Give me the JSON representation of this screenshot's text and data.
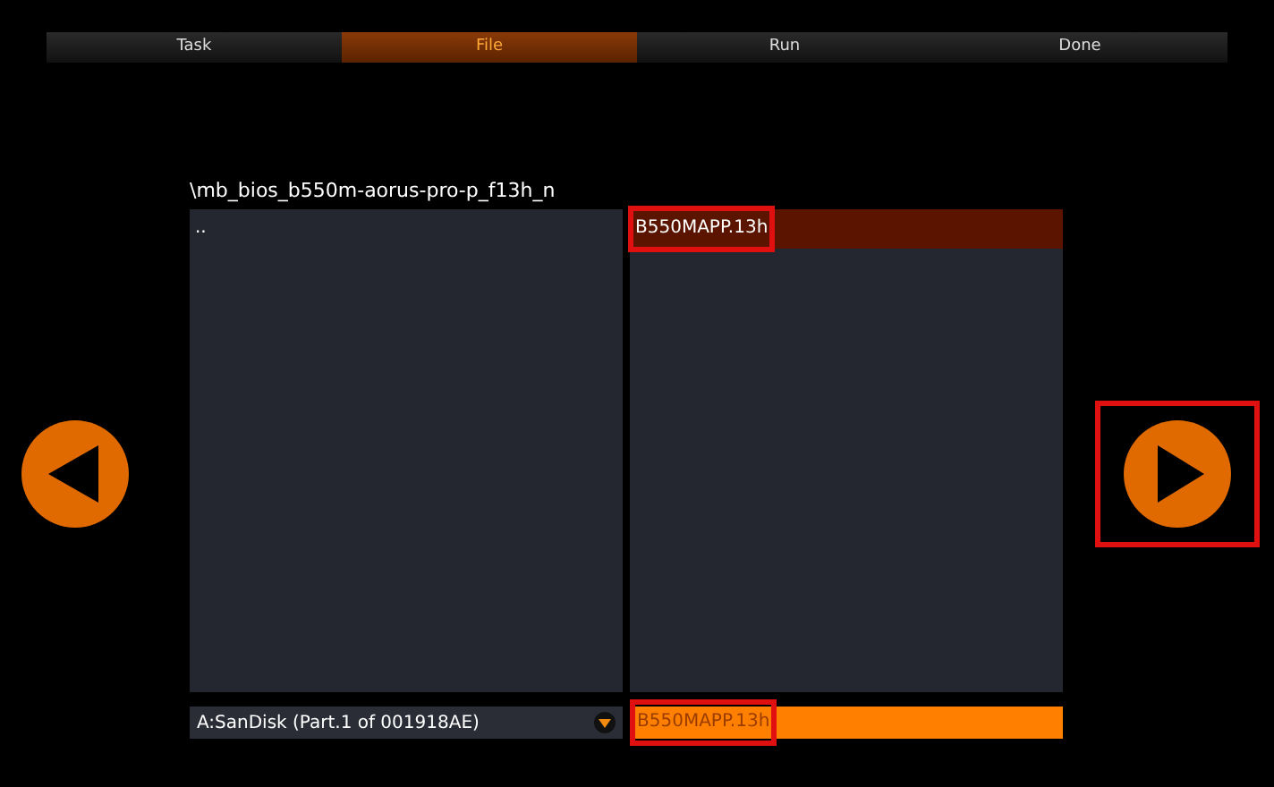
{
  "tabs": [
    {
      "label": "Task",
      "selected": false
    },
    {
      "label": "File",
      "selected": true
    },
    {
      "label": "Run",
      "selected": false
    },
    {
      "label": "Done",
      "selected": false
    }
  ],
  "path": "\\mb_bios_b550m-aorus-pro-p_f13h_n",
  "left_pane": {
    "items": [
      {
        "name": "..",
        "selected": false,
        "highlighted": false
      }
    ]
  },
  "right_pane": {
    "items": [
      {
        "name": "B550MAPP.13h",
        "selected": true,
        "highlighted": true
      }
    ]
  },
  "drive": {
    "label": "A:SanDisk (Part.1 of 001918AE)"
  },
  "file_field": {
    "value": "B550MAPP.13h",
    "highlighted": true
  },
  "nav": {
    "back": {
      "highlighted": false
    },
    "next": {
      "highlighted": true
    }
  }
}
